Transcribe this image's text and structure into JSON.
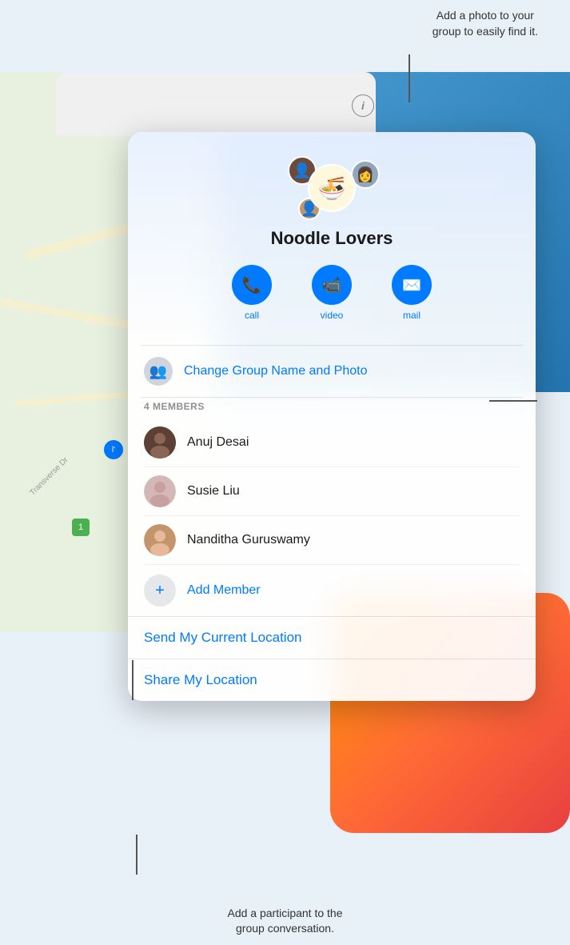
{
  "annotations": {
    "top": "Add a photo to your\ngroup to easily find it.",
    "bottom": "Add a participant to the\ngroup conversation."
  },
  "background_panel": {
    "info_button": "ℹ"
  },
  "card": {
    "group_name": "Noodle Lovers",
    "group_emoji": "🍜",
    "action_buttons": [
      {
        "id": "call",
        "icon": "📞",
        "label": "call"
      },
      {
        "id": "video",
        "icon": "📹",
        "label": "video"
      },
      {
        "id": "mail",
        "icon": "✉️",
        "label": "mail"
      }
    ],
    "change_group_label": "Change Group Name and Photo",
    "members_header": "4 MEMBERS",
    "members": [
      {
        "name": "Anuj Desai",
        "color": "#5c4033"
      },
      {
        "name": "Susie Liu",
        "color": "#b0a0a0"
      },
      {
        "name": "Nanditha Guruswamy",
        "color": "#c4956a"
      }
    ],
    "add_member_label": "Add Member",
    "location_buttons": [
      {
        "id": "send-location",
        "label": "Send My Current Location"
      },
      {
        "id": "share-location",
        "label": "Share My Location"
      }
    ]
  },
  "map": {
    "road_label": "Transverse Dr",
    "marker_label": "l'",
    "number_label": "1"
  }
}
